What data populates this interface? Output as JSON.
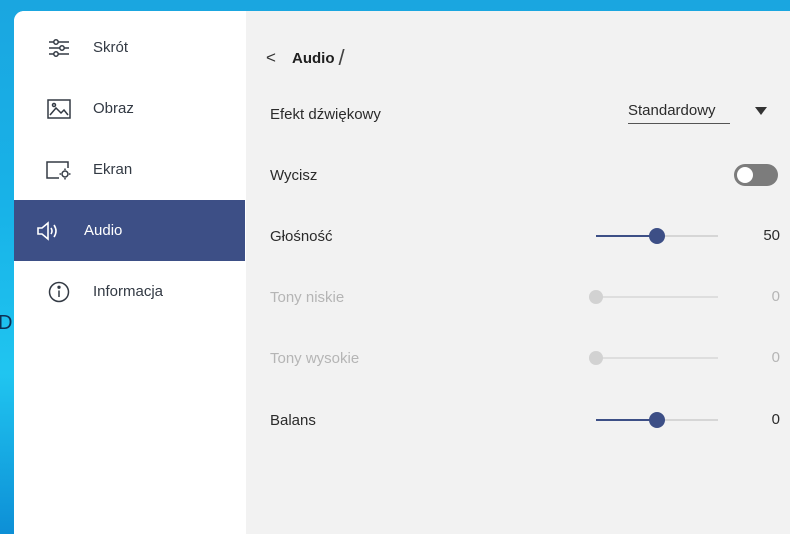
{
  "sidebar": {
    "items": [
      {
        "label": "Skrót",
        "icon": "sliders-icon",
        "active": false
      },
      {
        "label": "Obraz",
        "icon": "image-icon",
        "active": false
      },
      {
        "label": "Ekran",
        "icon": "screen-settings-icon",
        "active": false
      },
      {
        "label": "Audio",
        "icon": "speaker-icon",
        "active": true
      },
      {
        "label": "Informacja",
        "icon": "info-icon",
        "active": false
      }
    ]
  },
  "header": {
    "back_glyph": "<",
    "title": "Audio",
    "separator": "/"
  },
  "settings": {
    "sound_effect": {
      "label": "Efekt dźwiękowy",
      "value": "Standardowy"
    },
    "mute": {
      "label": "Wycisz",
      "on": false
    },
    "volume": {
      "label": "Głośność",
      "value": "50",
      "fraction": 0.5,
      "enabled": true
    },
    "bass": {
      "label": "Tony niskie",
      "value": "0",
      "fraction": 0.0,
      "enabled": false
    },
    "treble": {
      "label": "Tony wysokie",
      "value": "0",
      "fraction": 0.0,
      "enabled": false
    },
    "balance": {
      "label": "Balans",
      "value": "0",
      "fraction": 0.5,
      "enabled": true
    }
  },
  "background": {
    "edge_glyph": "D"
  },
  "colors": {
    "accent": "#3d4f86",
    "panel_bg": "#f2f2f2",
    "toggle_off": "#7c7c7c",
    "backdrop": "#1aa6e0"
  }
}
